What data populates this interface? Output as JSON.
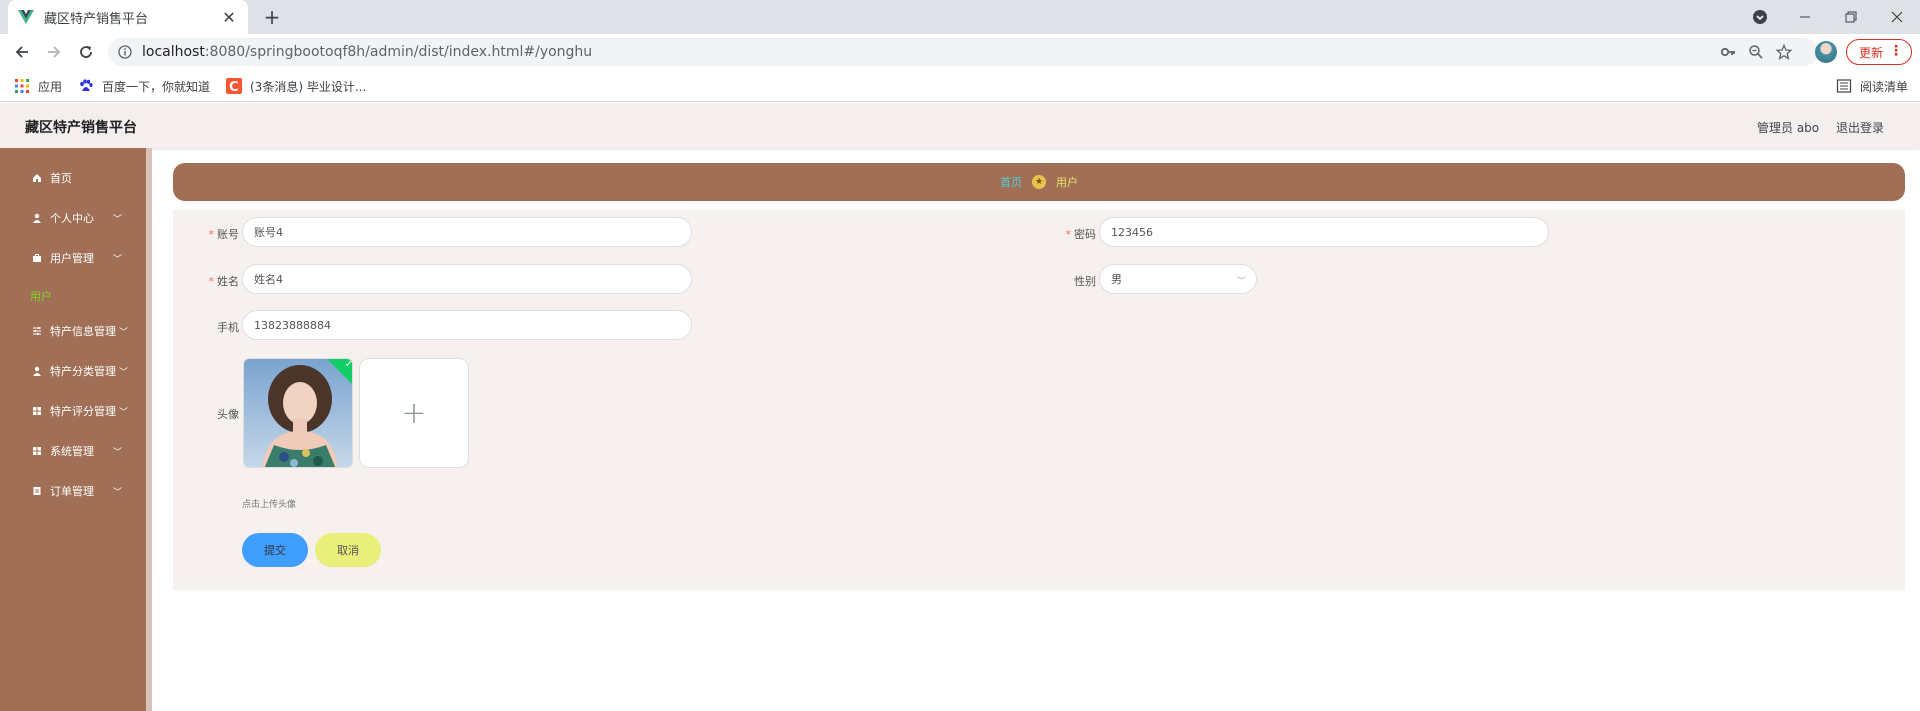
{
  "browser": {
    "tab_title": "藏区特产销售平台",
    "tab_close": "✕",
    "new_tab": "+",
    "url_host": "localhost",
    "url_path": ":8080/springbootoqf8h/admin/dist/index.html#/yonghu",
    "update_label": "更新",
    "update_menu": "⋮",
    "bookmarks": [
      {
        "label": "应用"
      },
      {
        "label": "百度一下，你就知道"
      },
      {
        "label": "(3条消息) 毕业设计..."
      }
    ],
    "reading_list": "阅读清单"
  },
  "header": {
    "title": "藏区特产销售平台",
    "user": "管理员 abo",
    "logout": "退出登录"
  },
  "sidebar": {
    "items": [
      {
        "label": "首页",
        "icon": "home-icon"
      },
      {
        "label": "个人中心",
        "icon": "user-icon"
      },
      {
        "label": "用户管理",
        "icon": "briefcase-icon"
      },
      {
        "label": "特产信息管理",
        "icon": "sliders-icon"
      },
      {
        "label": "特产分类管理",
        "icon": "user-icon"
      },
      {
        "label": "特产评分管理",
        "icon": "grid-icon"
      },
      {
        "label": "系统管理",
        "icon": "grid-icon"
      },
      {
        "label": "订单管理",
        "icon": "document-icon"
      }
    ],
    "active_sub": "用户",
    "accent_color": "#7ed321",
    "bg_color": "#a06f55"
  },
  "breadcrumb": {
    "home": "首页",
    "current": "用户"
  },
  "form": {
    "account_label": "账号",
    "account_value": "账号4",
    "password_label": "密码",
    "password_value": "123456",
    "name_label": "姓名",
    "name_value": "姓名4",
    "gender_label": "性别",
    "gender_value": "男",
    "phone_label": "手机",
    "phone_value": "13823888884",
    "avatar_label": "头像",
    "upload_tip": "点击上传头像",
    "upload_plus": "+",
    "submit_label": "提交",
    "cancel_label": "取消"
  }
}
